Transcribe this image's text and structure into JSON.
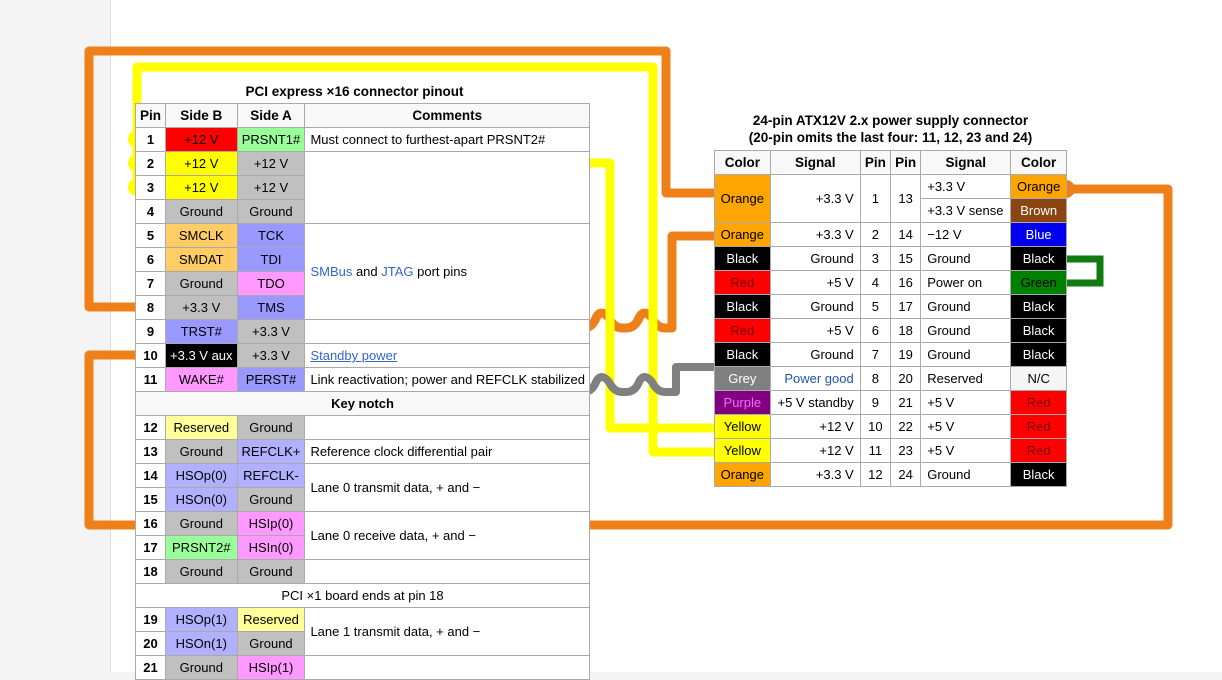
{
  "pcie": {
    "title": "PCI express ×16 connector pinout",
    "headers": [
      "Pin",
      "Side B",
      "Side A",
      "Comments"
    ],
    "rows": [
      {
        "pin": "1",
        "b": "+12 V",
        "bc": "c-red",
        "a": "PRSNT1#",
        "ac": "c-greenlt",
        "comment": "Must connect to furthest-apart PRSNT2#",
        "cspan": 1
      },
      {
        "pin": "2",
        "b": "+12 V",
        "bc": "c-yellow",
        "a": "+12 V",
        "ac": "c-grey",
        "comment": "",
        "cspan": 3
      },
      {
        "pin": "3",
        "b": "+12 V",
        "bc": "c-yellow",
        "a": "+12 V",
        "ac": "c-grey",
        "comment": null
      },
      {
        "pin": "4",
        "b": "Ground",
        "bc": "c-grey",
        "a": "Ground",
        "ac": "c-grey",
        "comment": null
      },
      {
        "pin": "5",
        "b": "SMCLK",
        "bc": "c-orangelt",
        "a": "TCK",
        "ac": "c-violet",
        "comment": "",
        "cspan": 4
      },
      {
        "pin": "6",
        "b": "SMDAT",
        "bc": "c-orangelt",
        "a": "TDI",
        "ac": "c-violet",
        "comment": null
      },
      {
        "pin": "7",
        "b": "Ground",
        "bc": "c-grey",
        "a": "TDO",
        "ac": "c-pink",
        "comment": null
      },
      {
        "pin": "8",
        "b": "+3.3 V",
        "bc": "c-grey",
        "a": "TMS",
        "ac": "c-violet",
        "comment": null
      },
      {
        "pin": "9",
        "b": "TRST#",
        "bc": "c-violet",
        "a": "+3.3 V",
        "ac": "c-grey",
        "comment": "",
        "cspan": 1
      },
      {
        "pin": "10",
        "b": "+3.3 V aux",
        "bc": "c-black",
        "a": "+3.3 V",
        "ac": "c-grey",
        "comment": "Standby power",
        "cspan": 1,
        "clink": "u"
      },
      {
        "pin": "11",
        "b": "WAKE#",
        "bc": "c-pink",
        "a": "PERST#",
        "ac": "c-violet",
        "comment": "Link reactivation; power and REFCLK stabilized",
        "cspan": 1
      }
    ],
    "smbus_comment_parts": [
      "SMBus",
      " and ",
      "JTAG",
      " port pins"
    ],
    "key_notch": "Key notch",
    "rows2": [
      {
        "pin": "12",
        "b": "Reserved",
        "bc": "c-yellowlt",
        "a": "Ground",
        "ac": "c-grey",
        "comment": "",
        "cspan": 1
      },
      {
        "pin": "13",
        "b": "Ground",
        "bc": "c-grey",
        "a": "REFCLK+",
        "ac": "c-lilac",
        "comment": "Reference clock differential pair",
        "cspan": 1
      },
      {
        "pin": "14",
        "b": "HSOp(0)",
        "bc": "c-lilac",
        "a": "REFCLK-",
        "ac": "c-lilac",
        "comment": "Lane 0 transmit data, + and −",
        "cspan": 2
      },
      {
        "pin": "15",
        "b": "HSOn(0)",
        "bc": "c-lilac",
        "a": "Ground",
        "ac": "c-grey",
        "comment": null
      },
      {
        "pin": "16",
        "b": "Ground",
        "bc": "c-grey",
        "a": "HSIp(0)",
        "ac": "c-pink",
        "comment": "Lane 0 receive data, + and −",
        "cspan": 2
      },
      {
        "pin": "17",
        "b": "PRSNT2#",
        "bc": "c-greenlt",
        "a": "HSIn(0)",
        "ac": "c-pink",
        "comment": null
      },
      {
        "pin": "18",
        "b": "Ground",
        "bc": "c-grey",
        "a": "Ground",
        "ac": "c-grey",
        "comment": "",
        "cspan": 1
      }
    ],
    "end_note": "PCI ×1 board ends at pin 18",
    "rows3": [
      {
        "pin": "19",
        "b": "HSOp(1)",
        "bc": "c-lilac",
        "a": "Reserved",
        "ac": "c-yellowlt",
        "comment": "Lane 1 transmit data, + and −",
        "cspan": 2
      },
      {
        "pin": "20",
        "b": "HSOn(1)",
        "bc": "c-lilac",
        "a": "Ground",
        "ac": "c-grey",
        "comment": null
      },
      {
        "pin": "21",
        "b": "Ground",
        "bc": "c-grey",
        "a": "HSIp(1)",
        "ac": "c-pink",
        "comment": "",
        "cspan": 1
      }
    ]
  },
  "atx": {
    "title_line1": "24-pin ATX12V 2.x power supply connector",
    "title_line2": "(20-pin omits the last four: 11, 12, 23 and 24)",
    "headers": [
      "Color",
      "Signal",
      "Pin",
      "Pin",
      "Signal",
      "Color"
    ],
    "rows": [
      {
        "colorL": "Orange",
        "colorLc": "a-orange",
        "sigL": "+3.3 V",
        "pinL": "1",
        "pinR": "13",
        "sigR": "+3.3 V",
        "sigRc": "",
        "colorR": "Orange",
        "colorRc": "a-orange",
        "split": true,
        "sigR2": "+3.3 V sense",
        "sigR2c": "a-ltblue",
        "colorR2": "Brown",
        "colorR2c": "a-brown"
      },
      {
        "colorL": "Orange",
        "colorLc": "a-orange",
        "sigL": "+3.3 V",
        "pinL": "2",
        "pinR": "14",
        "sigR": "−12 V",
        "sigRc": "",
        "colorR": "Blue",
        "colorRc": "a-blue"
      },
      {
        "colorL": "Black",
        "colorLc": "a-black",
        "sigL": "Ground",
        "pinL": "3",
        "pinR": "15",
        "sigR": "Ground",
        "sigRc": "",
        "colorR": "Black",
        "colorRc": "a-black"
      },
      {
        "colorL": "Red",
        "colorLc": "a-red",
        "sigL": "+5 V",
        "pinL": "4",
        "pinR": "16",
        "sigR": "Power on",
        "sigRc": "a-ltblue",
        "colorR": "Green",
        "colorRc": "a-green"
      },
      {
        "colorL": "Black",
        "colorLc": "a-black",
        "sigL": "Ground",
        "pinL": "5",
        "pinR": "17",
        "sigR": "Ground",
        "sigRc": "",
        "colorR": "Black",
        "colorRc": "a-black"
      },
      {
        "colorL": "Red",
        "colorLc": "a-red",
        "sigL": "+5 V",
        "pinL": "6",
        "pinR": "18",
        "sigR": "Ground",
        "sigRc": "",
        "colorR": "Black",
        "colorRc": "a-black"
      },
      {
        "colorL": "Black",
        "colorLc": "a-black",
        "sigL": "Ground",
        "pinL": "7",
        "pinR": "19",
        "sigR": "Ground",
        "sigRc": "",
        "colorR": "Black",
        "colorRc": "a-black"
      },
      {
        "colorL": "Grey",
        "colorLc": "a-grey",
        "sigL": "Power good",
        "sigLc": "a-ltblue-l",
        "pinL": "8",
        "pinR": "20",
        "sigR": "Reserved",
        "sigRc": "",
        "colorR": "N/C",
        "colorRc": "a-nc"
      },
      {
        "colorL": "Purple",
        "colorLc": "a-purple",
        "sigL": "+5 V standby",
        "pinL": "9",
        "pinR": "21",
        "sigR": "+5 V",
        "sigRc": "",
        "colorR": "Red",
        "colorRc": "a-red"
      },
      {
        "colorL": "Yellow",
        "colorLc": "a-yellow",
        "sigL": "+12 V",
        "pinL": "10",
        "pinR": "22",
        "sigR": "+5 V",
        "sigRc": "",
        "colorR": "Red",
        "colorRc": "a-red"
      },
      {
        "colorL": "Yellow",
        "colorLc": "a-yellow",
        "sigL": "+12 V",
        "pinL": "11",
        "pinR": "23",
        "sigR": "+5 V",
        "sigRc": "",
        "colorR": "Red",
        "colorRc": "a-red"
      },
      {
        "colorL": "Orange",
        "colorLc": "a-orange",
        "sigL": "+3.3 V",
        "pinL": "12",
        "pinR": "24",
        "sigR": "Ground",
        "sigRc": "",
        "colorR": "Black",
        "colorRc": "a-black"
      }
    ]
  },
  "wires": {
    "orange_hex": "#ef8019",
    "yellow_hex": "#ffff00",
    "grey_hex": "#808080",
    "green_hex": "#117a11",
    "labels": {
      "orange": "orange-3v3-wire",
      "yellow": "yellow-12v-wire",
      "grey": "grey-power-good-wire",
      "green": "green-power-on-jumper"
    }
  }
}
